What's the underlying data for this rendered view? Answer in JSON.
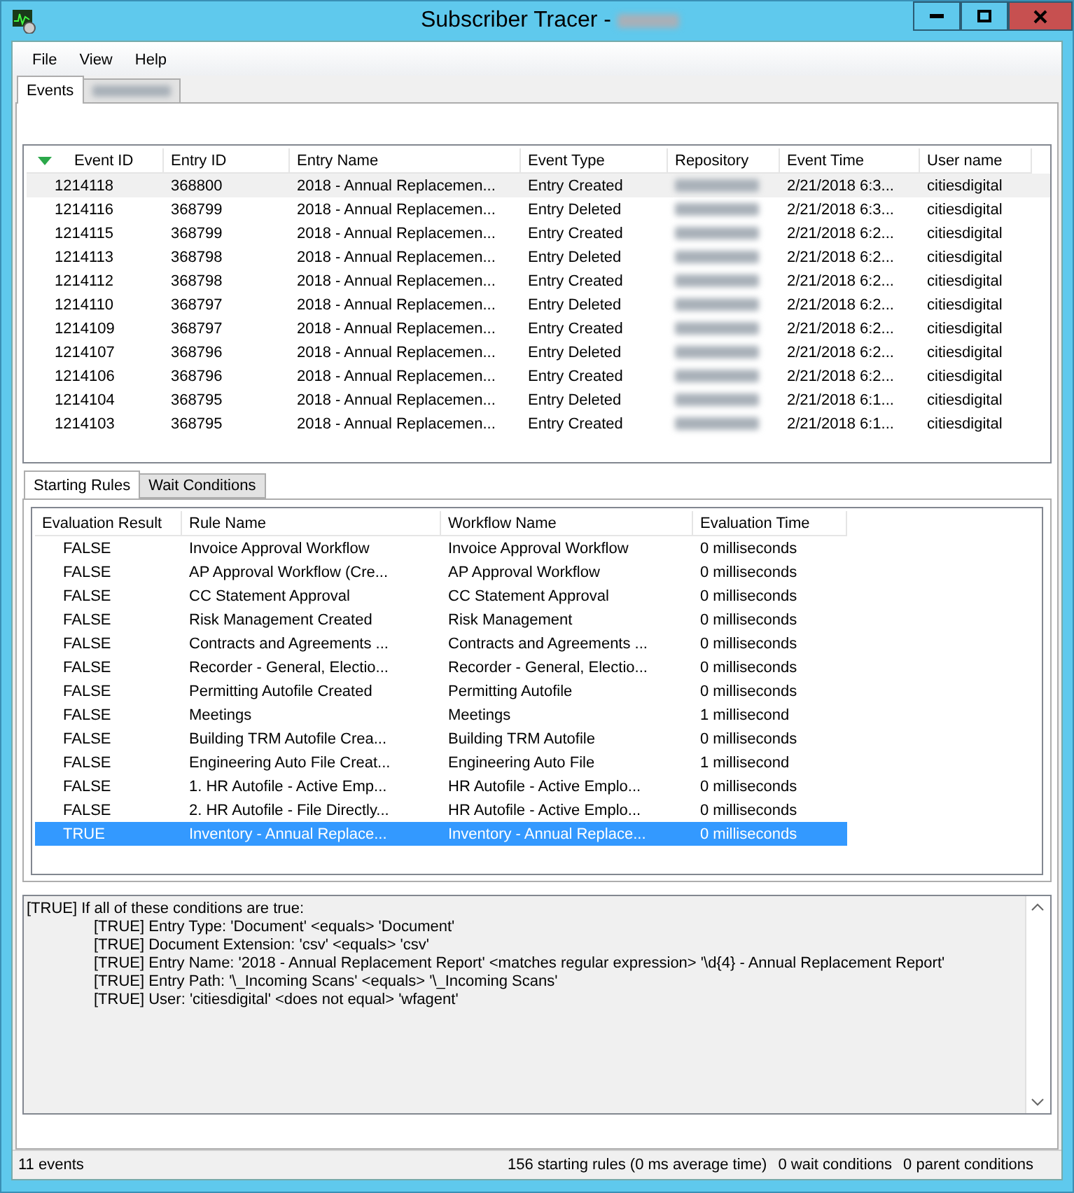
{
  "window": {
    "title": "Subscriber Tracer -"
  },
  "menu": [
    "File",
    "View",
    "Help"
  ],
  "tabs": [
    {
      "label": "Events",
      "selected": true
    },
    {
      "selected": false,
      "redacted": true
    }
  ],
  "events": {
    "columns": [
      "Event ID",
      "Entry ID",
      "Entry Name",
      "Event Type",
      "Repository",
      "Event Time",
      "User name"
    ],
    "rows": [
      {
        "cells": [
          "1214118",
          "368800",
          "2018 - Annual Replacemen...",
          "Entry Created",
          "",
          "2/21/2018 6:3...",
          "citiesdigital"
        ],
        "selected": true
      },
      {
        "cells": [
          "1214116",
          "368799",
          "2018 - Annual Replacemen...",
          "Entry Deleted",
          "",
          "2/21/2018 6:3...",
          "citiesdigital"
        ],
        "selected": false
      },
      {
        "cells": [
          "1214115",
          "368799",
          "2018 - Annual Replacemen...",
          "Entry Created",
          "",
          "2/21/2018 6:2...",
          "citiesdigital"
        ],
        "selected": false
      },
      {
        "cells": [
          "1214113",
          "368798",
          "2018 - Annual Replacemen...",
          "Entry Deleted",
          "",
          "2/21/2018 6:2...",
          "citiesdigital"
        ],
        "selected": false
      },
      {
        "cells": [
          "1214112",
          "368798",
          "2018 - Annual Replacemen...",
          "Entry Created",
          "",
          "2/21/2018 6:2...",
          "citiesdigital"
        ],
        "selected": false
      },
      {
        "cells": [
          "1214110",
          "368797",
          "2018 - Annual Replacemen...",
          "Entry Deleted",
          "",
          "2/21/2018 6:2...",
          "citiesdigital"
        ],
        "selected": false
      },
      {
        "cells": [
          "1214109",
          "368797",
          "2018 - Annual Replacemen...",
          "Entry Created",
          "",
          "2/21/2018 6:2...",
          "citiesdigital"
        ],
        "selected": false
      },
      {
        "cells": [
          "1214107",
          "368796",
          "2018 - Annual Replacemen...",
          "Entry Deleted",
          "",
          "2/21/2018 6:2...",
          "citiesdigital"
        ],
        "selected": false
      },
      {
        "cells": [
          "1214106",
          "368796",
          "2018 - Annual Replacemen...",
          "Entry Created",
          "",
          "2/21/2018 6:2...",
          "citiesdigital"
        ],
        "selected": false
      },
      {
        "cells": [
          "1214104",
          "368795",
          "2018 - Annual Replacemen...",
          "Entry Deleted",
          "",
          "2/21/2018 6:1...",
          "citiesdigital"
        ],
        "selected": false
      },
      {
        "cells": [
          "1214103",
          "368795",
          "2018 - Annual Replacemen...",
          "Entry Created",
          "",
          "2/21/2018 6:1...",
          "citiesdigital"
        ],
        "selected": false
      }
    ]
  },
  "rule_tabs": [
    {
      "label": "Starting Rules",
      "selected": true
    },
    {
      "label": "Wait Conditions",
      "selected": false
    }
  ],
  "rules": {
    "columns": [
      "Evaluation Result",
      "Rule Name",
      "Workflow Name",
      "Evaluation Time"
    ],
    "rows": [
      {
        "cells": [
          "FALSE",
          "Invoice Approval Workflow",
          "Invoice Approval Workflow",
          "0 milliseconds"
        ],
        "selected": false
      },
      {
        "cells": [
          "FALSE",
          "AP Approval Workflow (Cre...",
          "AP Approval Workflow",
          "0 milliseconds"
        ],
        "selected": false
      },
      {
        "cells": [
          "FALSE",
          "CC Statement Approval",
          "CC Statement Approval",
          "0 milliseconds"
        ],
        "selected": false
      },
      {
        "cells": [
          "FALSE",
          "Risk Management Created",
          "Risk Management",
          "0 milliseconds"
        ],
        "selected": false
      },
      {
        "cells": [
          "FALSE",
          "Contracts and Agreements ...",
          "Contracts and Agreements ...",
          "0 milliseconds"
        ],
        "selected": false
      },
      {
        "cells": [
          "FALSE",
          "Recorder - General, Electio...",
          "Recorder - General, Electio...",
          "0 milliseconds"
        ],
        "selected": false
      },
      {
        "cells": [
          "FALSE",
          "Permitting Autofile Created",
          "Permitting Autofile",
          "0 milliseconds"
        ],
        "selected": false
      },
      {
        "cells": [
          "FALSE",
          "Meetings",
          "Meetings",
          "1 millisecond"
        ],
        "selected": false
      },
      {
        "cells": [
          "FALSE",
          "Building TRM Autofile Crea...",
          "Building TRM Autofile",
          "0 milliseconds"
        ],
        "selected": false
      },
      {
        "cells": [
          "FALSE",
          "Engineering Auto File Creat...",
          "Engineering Auto File",
          "1 millisecond"
        ],
        "selected": false
      },
      {
        "cells": [
          "FALSE",
          "1. HR Autofile - Active Emp...",
          "HR Autofile - Active Emplo...",
          "0 milliseconds"
        ],
        "selected": false
      },
      {
        "cells": [
          "FALSE",
          "2. HR Autofile - File Directly...",
          "HR Autofile - Active Emplo...",
          "0 milliseconds"
        ],
        "selected": false
      },
      {
        "cells": [
          "TRUE",
          "Inventory - Annual Replace...",
          "Inventory - Annual Replace...",
          "0 milliseconds"
        ],
        "selected": true
      }
    ]
  },
  "details": {
    "heading": "[TRUE] If all of these conditions are true:",
    "conditions": [
      "[TRUE] Entry Type: 'Document' <equals> 'Document'",
      "[TRUE] Document Extension: 'csv' <equals> 'csv'",
      "[TRUE] Entry Name: '2018 - Annual Replacement Report' <matches regular expression> '\\d{4} - Annual Replacement Report'",
      "[TRUE] Entry Path: '\\_Incoming Scans' <equals> '\\_Incoming Scans'",
      "[TRUE] User: 'citiesdigital' <does not equal> 'wfagent'"
    ]
  },
  "status_bar": {
    "left": "11 events",
    "right": [
      "156 starting rules (0 ms average time)",
      "0 wait conditions",
      "0 parent conditions"
    ]
  }
}
